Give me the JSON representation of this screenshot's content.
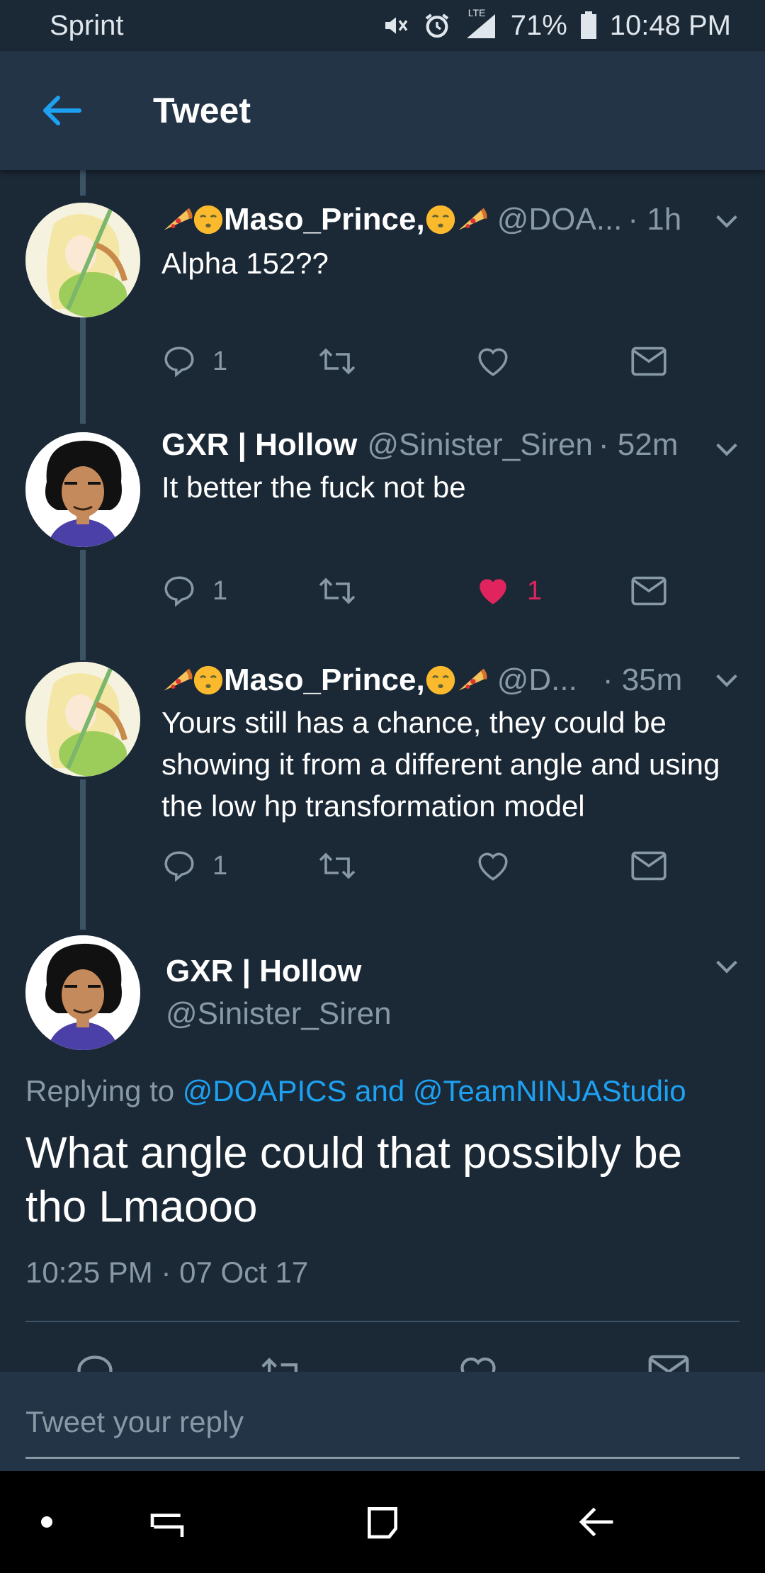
{
  "status": {
    "carrier": "Sprint",
    "network": "LTE",
    "battery": "71%",
    "time": "10:48 PM"
  },
  "appbar": {
    "title": "Tweet"
  },
  "tweets": [
    {
      "name": "Maso_Prince,",
      "handle": "@DOA...",
      "time": "· 1h",
      "text": "Alpha 152??",
      "replies": "1",
      "likes": "",
      "liked": false
    },
    {
      "name": "GXR | Hollow",
      "handle": "@Sinister_Siren",
      "time": "· 52m",
      "text": "It better the fuck not be",
      "replies": "1",
      "likes": "1",
      "liked": true
    },
    {
      "name": "Maso_Prince,",
      "handle": "@D...",
      "time": "· 35m",
      "text": "Yours still has a chance, they could be showing it from a different angle and using the low hp transformation model",
      "replies": "1",
      "likes": "",
      "liked": false
    }
  ],
  "focused": {
    "name": "GXR | Hollow",
    "handle": "@Sinister_Siren",
    "replying_prefix": "Replying to ",
    "replying_to": "@DOAPICS and @TeamNINJAStudio",
    "text": "What angle could that possibly be tho Lmaooo",
    "timestamp": "10:25 PM · 07 Oct 17"
  },
  "composer": {
    "placeholder": "Tweet your reply"
  },
  "colors": {
    "background": "#1b2836",
    "appbar": "#243447",
    "accent": "#1da1f2",
    "like": "#e0245e",
    "muted": "#8899a6"
  },
  "icons": [
    "back-arrow-icon",
    "reply-icon",
    "retweet-icon",
    "heart-icon",
    "dm-icon",
    "chevron-down-icon",
    "pizza-emoji",
    "blush-emoji"
  ]
}
